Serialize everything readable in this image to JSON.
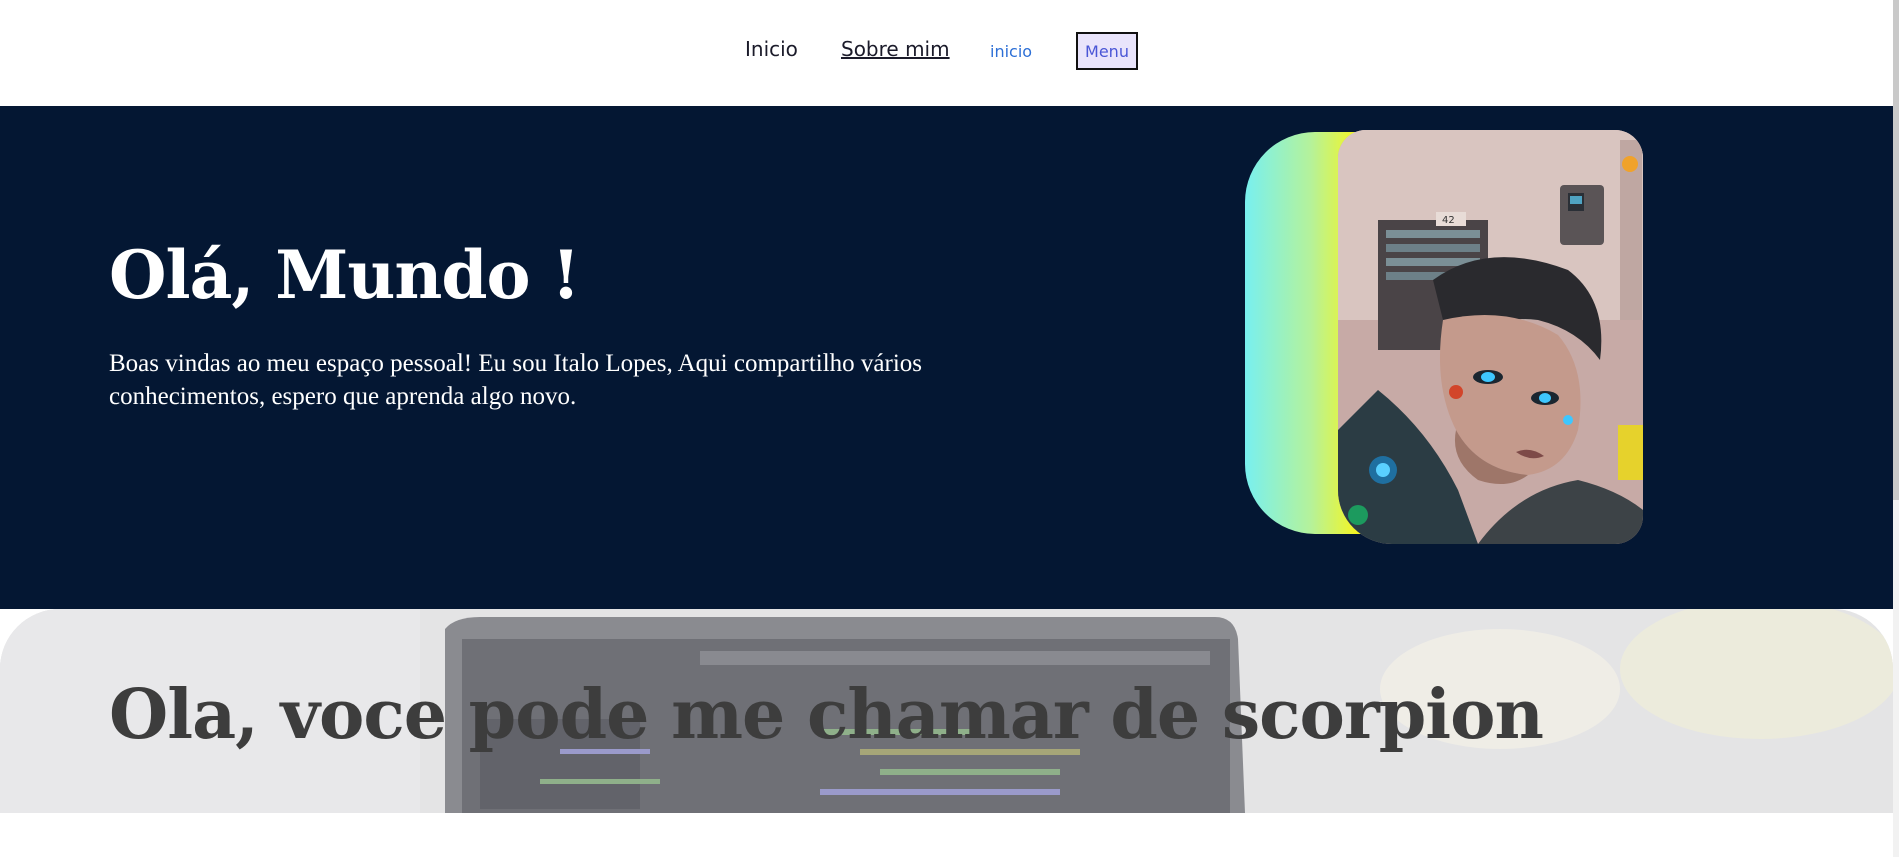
{
  "nav": {
    "items": [
      {
        "label": "Inicio"
      },
      {
        "label": "Sobre mim"
      },
      {
        "label": "inicio"
      }
    ],
    "menu_label": "Menu"
  },
  "hero": {
    "title": "Olá, Mundo !",
    "text": "Boas vindas ao meu espaço pessoal! Eu sou Italo Lopes, Aqui compartilho vários conhecimentos, espero que aprenda algo novo.",
    "background_color": "#041733",
    "portrait_number": "42"
  },
  "about": {
    "title": "Ola, voce pode me chamar de scorpion"
  },
  "colors": {
    "link_blue": "#2d6fd6",
    "menu_bg": "#e9e4fb",
    "gradient_cyan": "#78f0f0",
    "gradient_yellow": "#fff50d"
  }
}
